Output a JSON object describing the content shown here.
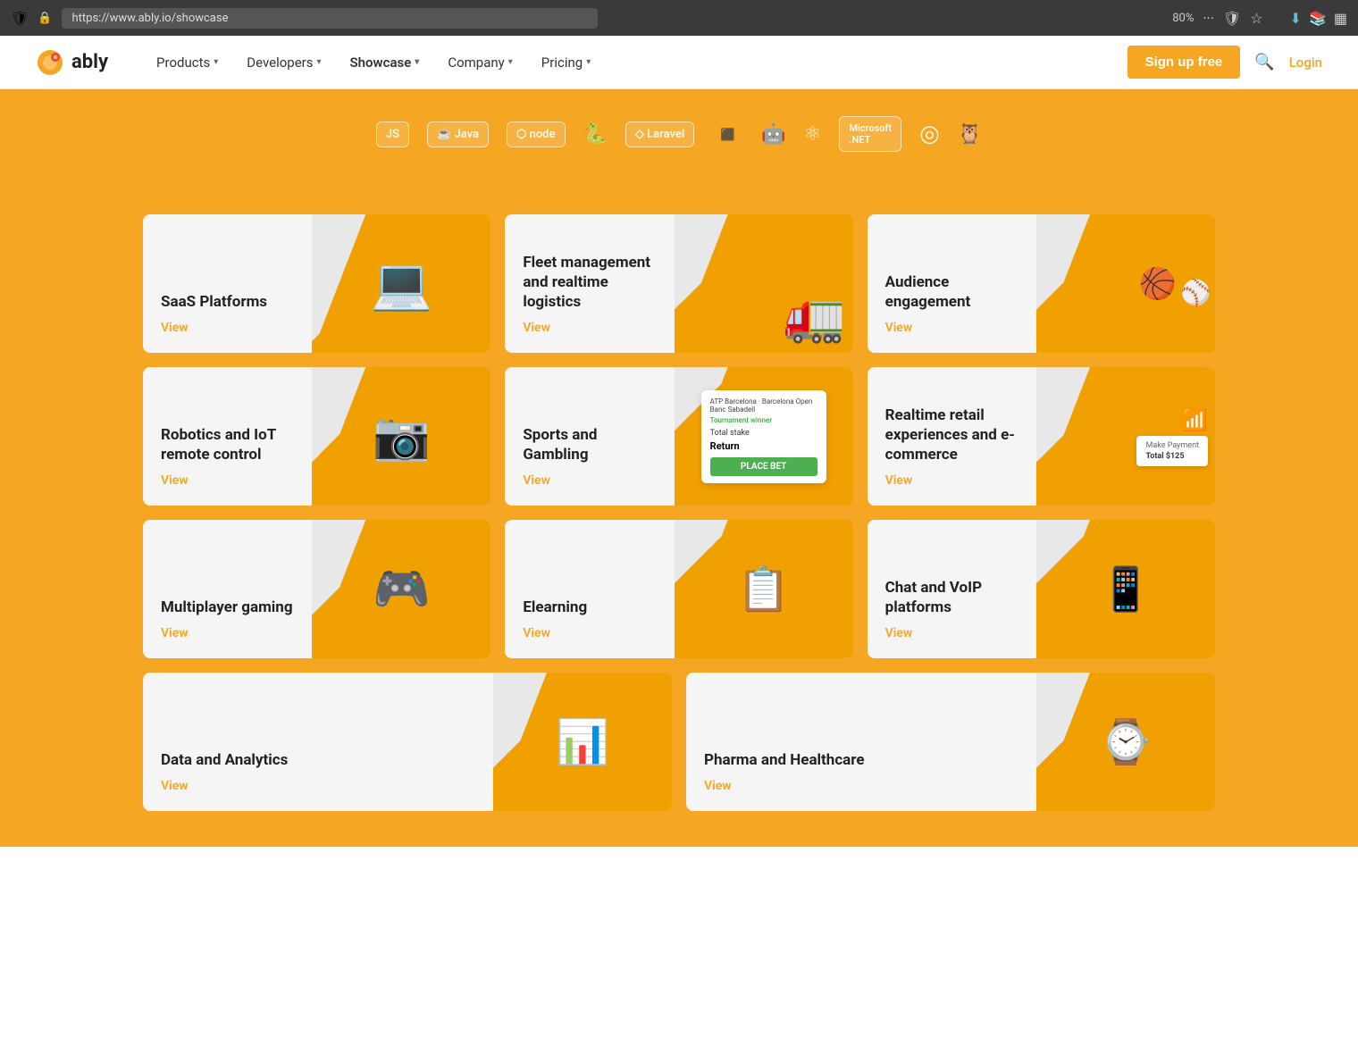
{
  "browser": {
    "url": "https://www.ably.io/showcase",
    "zoom": "80%"
  },
  "navbar": {
    "logo_text": "ably",
    "products_label": "Products",
    "developers_label": "Developers",
    "showcase_label": "Showcase",
    "company_label": "Company",
    "pricing_label": "Pricing",
    "signup_label": "Sign up free",
    "login_label": "Login"
  },
  "tech_icons": [
    {
      "label": "JS",
      "icon": "JS"
    },
    {
      "label": "Java",
      "icon": "☕ Java"
    },
    {
      "label": "Node",
      "icon": "⬡ node"
    },
    {
      "label": "Python",
      "icon": "🐍"
    },
    {
      "label": "Laravel",
      "icon": "◇ Laravel"
    },
    {
      "label": "Swift",
      "icon": "◾"
    },
    {
      "label": "Android",
      "icon": "🤖"
    },
    {
      "label": "React",
      "icon": "⚛"
    },
    {
      "label": "dotNET",
      "icon": "Microsoft .NET"
    },
    {
      "label": "pusher",
      "icon": "◎"
    },
    {
      "label": "owl",
      "icon": "🦉"
    }
  ],
  "cards": [
    {
      "id": "saas",
      "title": "SaaS Platforms",
      "view_label": "View",
      "image_type": "laptop"
    },
    {
      "id": "fleet",
      "title": "Fleet management and realtime logistics",
      "view_label": "View",
      "image_type": "truck"
    },
    {
      "id": "audience",
      "title": "Audience engagement",
      "view_label": "View",
      "image_type": "sports_balls"
    },
    {
      "id": "robotics",
      "title": "Robotics and IoT remote control",
      "view_label": "View",
      "image_type": "robot"
    },
    {
      "id": "sports",
      "title": "Sports and Gambling",
      "view_label": "View",
      "image_type": "betting"
    },
    {
      "id": "retail",
      "title": "Realtime retail experiences and e-commerce",
      "view_label": "View",
      "image_type": "retail"
    },
    {
      "id": "gaming",
      "title": "Multiplayer gaming",
      "view_label": "View",
      "image_type": "gaming"
    },
    {
      "id": "elearning",
      "title": "Elearning",
      "view_label": "View",
      "image_type": "elearning"
    },
    {
      "id": "chat",
      "title": "Chat and VoIP platforms",
      "view_label": "View",
      "image_type": "chat"
    },
    {
      "id": "data",
      "title": "Data and Analytics",
      "view_label": "View",
      "image_type": "data"
    },
    {
      "id": "pharma",
      "title": "Pharma and Healthcare",
      "view_label": "View",
      "image_type": "pharma"
    }
  ],
  "betting": {
    "header": "ATP Barcelona · Barcelona Open Banc Sabadell",
    "tournament": "Tournament winner",
    "total_stake_label": "Total stake",
    "return_label": "Return",
    "bet_button": "PLACE BET"
  },
  "retail": {
    "make_payment": "Make Payment",
    "total": "Total $125"
  }
}
